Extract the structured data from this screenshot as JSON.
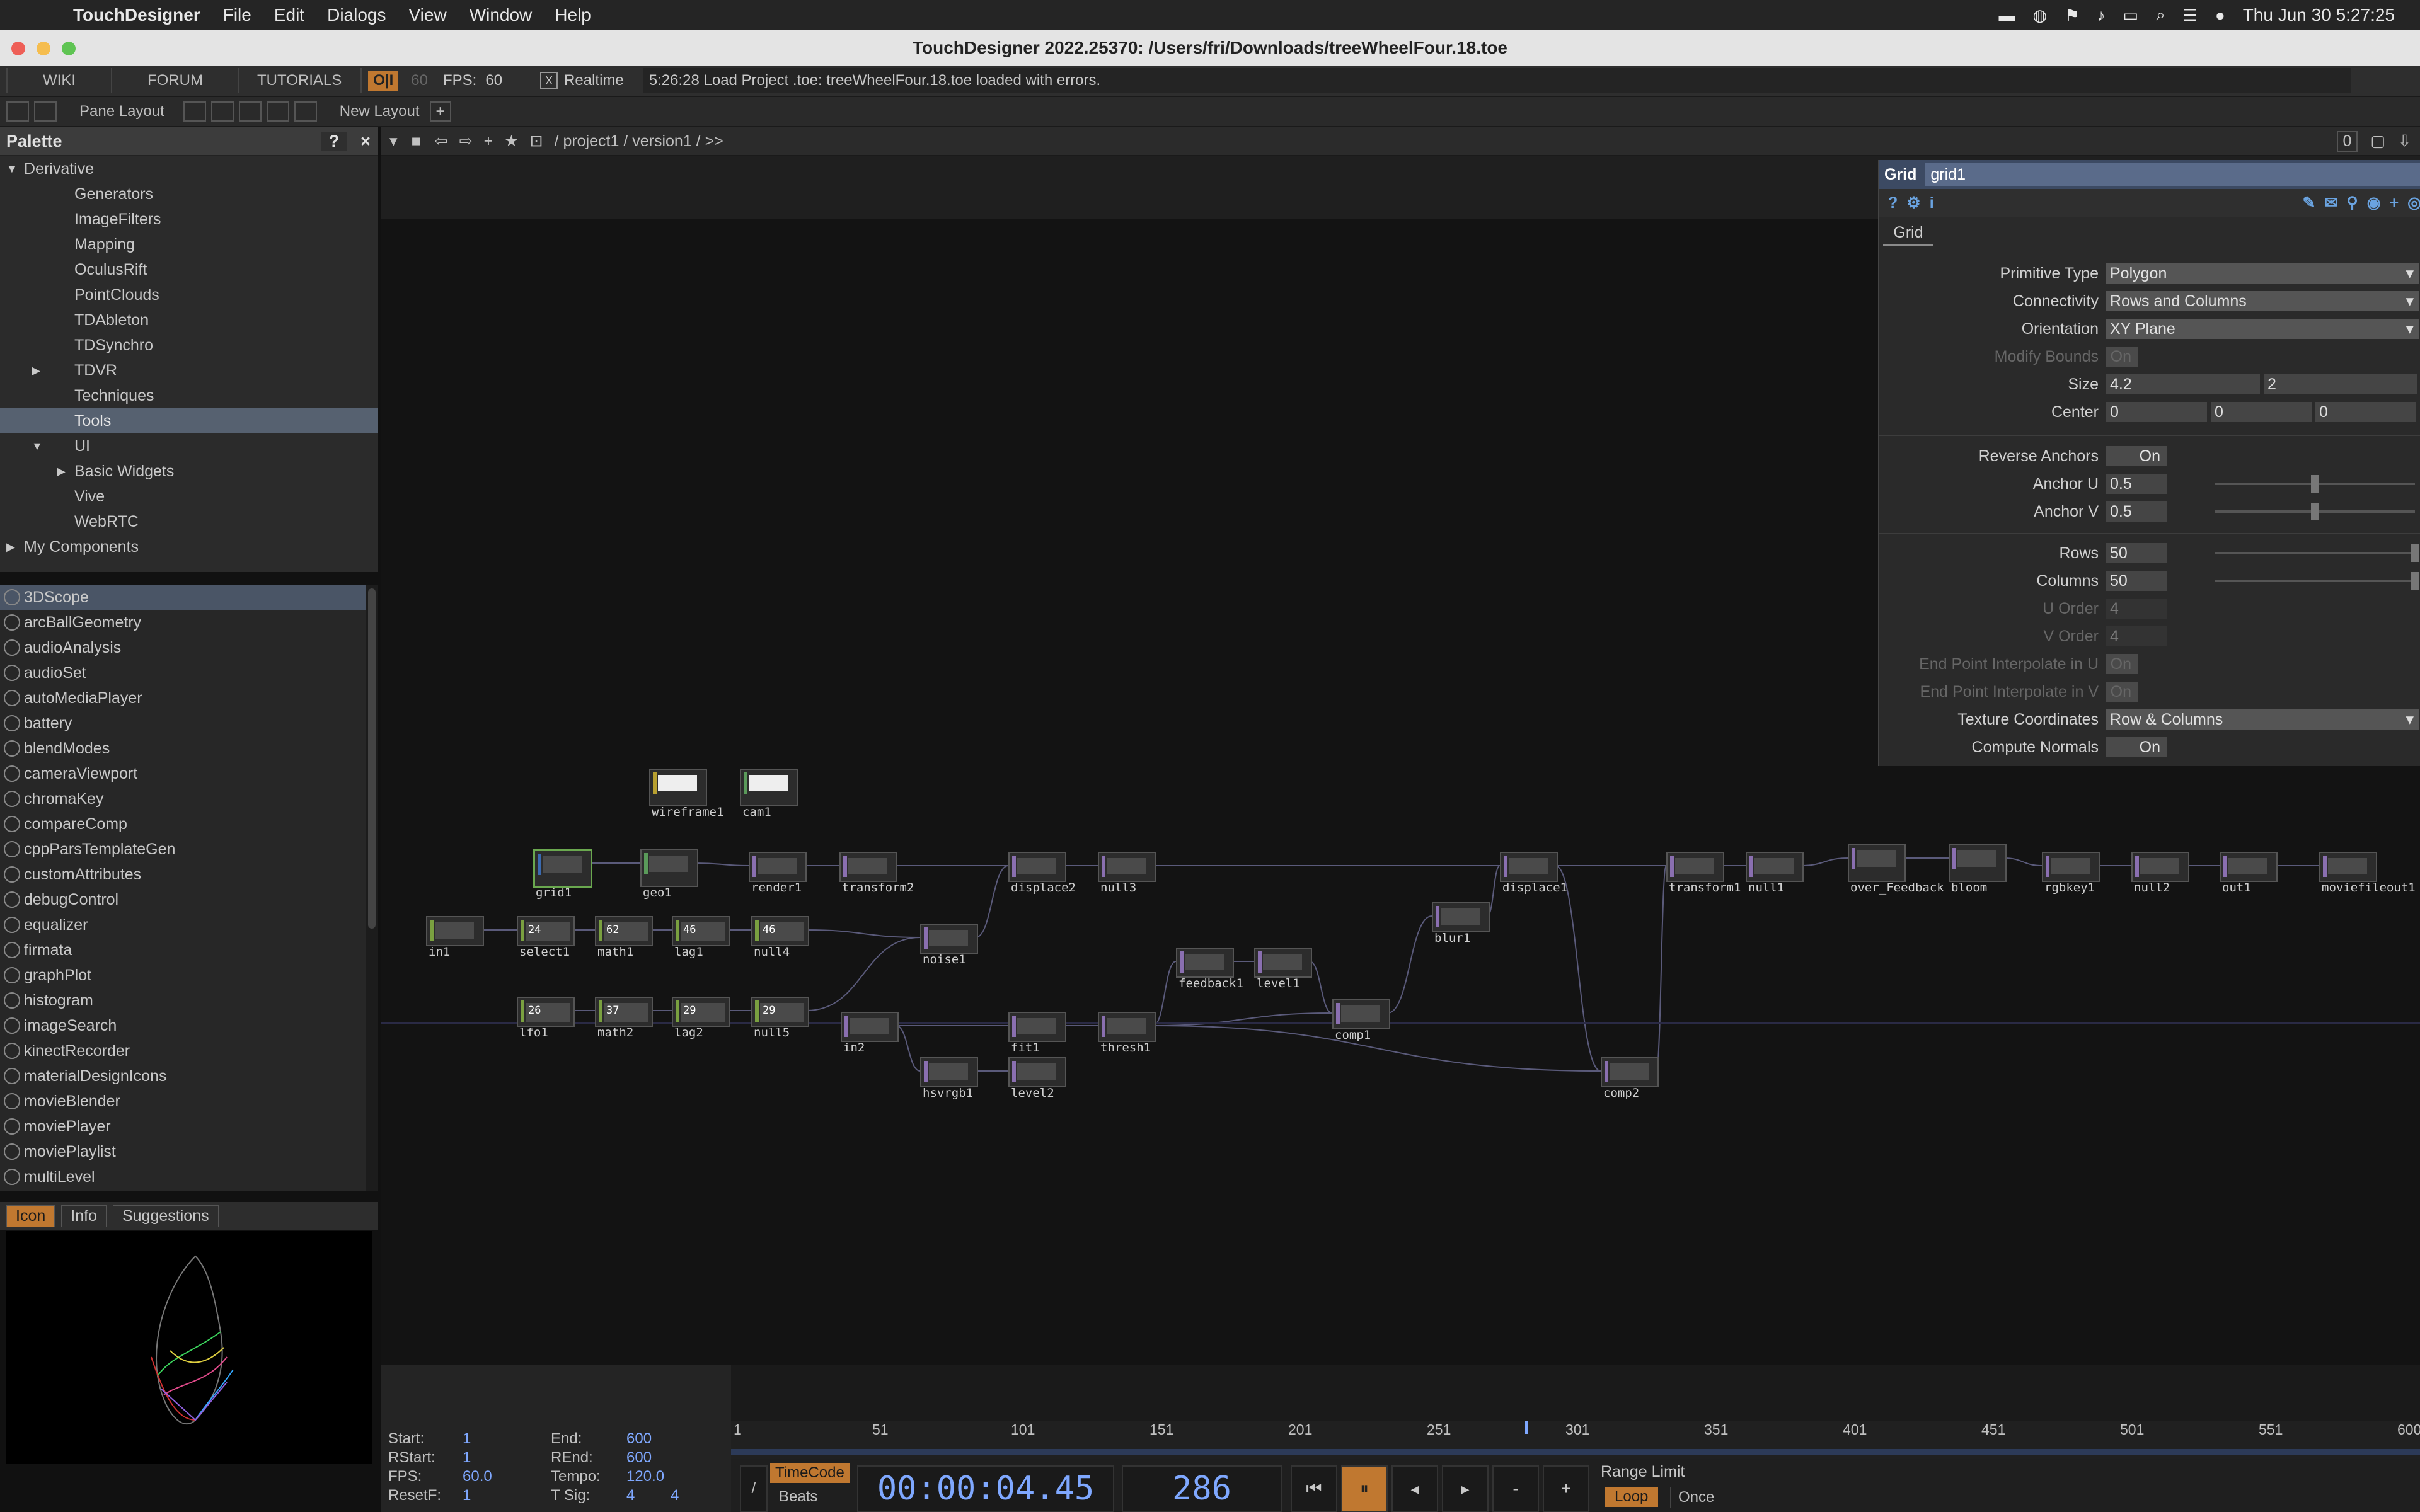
{
  "menubar": {
    "app": "TouchDesigner",
    "items": [
      "File",
      "Edit",
      "Dialogs",
      "View",
      "Window",
      "Help"
    ],
    "clock": "Thu Jun 30  5:27:25"
  },
  "window": {
    "title": "TouchDesigner 2022.25370: /Users/fri/Downloads/treeWheelFour.18.toe"
  },
  "toolbar": {
    "wiki": "WIKI",
    "forum": "FORUM",
    "tutorials": "TUTORIALS",
    "oi": "O|I",
    "fps_cap": "60",
    "fps_label": "FPS:",
    "fps_value": "60",
    "realtime_check": "X",
    "realtime": "Realtime",
    "status": "5:26:28 Load Project .toe: treeWheelFour.18.toe loaded with errors."
  },
  "layoutbar": {
    "pane_layout": "Pane Layout",
    "new_layout": "New Layout",
    "plus": "+"
  },
  "palette": {
    "title": "Palette",
    "help": "?",
    "close": "×",
    "tree": [
      {
        "label": "Derivative",
        "level": 0,
        "arrow": "down"
      },
      {
        "label": "Generators",
        "level": 1,
        "arrow": ""
      },
      {
        "label": "ImageFilters",
        "level": 1,
        "arrow": ""
      },
      {
        "label": "Mapping",
        "level": 1,
        "arrow": ""
      },
      {
        "label": "OculusRift",
        "level": 1,
        "arrow": ""
      },
      {
        "label": "PointClouds",
        "level": 1,
        "arrow": ""
      },
      {
        "label": "TDAbleton",
        "level": 1,
        "arrow": ""
      },
      {
        "label": "TDSynchro",
        "level": 1,
        "arrow": ""
      },
      {
        "label": "TDVR",
        "level": 1,
        "arrow": "right"
      },
      {
        "label": "Techniques",
        "level": 1,
        "arrow": ""
      },
      {
        "label": "Tools",
        "level": 1,
        "arrow": "",
        "selected": true
      },
      {
        "label": "UI",
        "level": 1,
        "arrow": "down"
      },
      {
        "label": "Basic Widgets",
        "level": 2,
        "arrow": "right"
      },
      {
        "label": "Vive",
        "level": 1,
        "arrow": ""
      },
      {
        "label": "WebRTC",
        "level": 1,
        "arrow": ""
      },
      {
        "label": "My Components",
        "level": 0,
        "arrow": "right"
      }
    ],
    "components": [
      "3DScope",
      "arcBallGeometry",
      "audioAnalysis",
      "audioSet",
      "autoMediaPlayer",
      "battery",
      "blendModes",
      "cameraViewport",
      "chromaKey",
      "compareComp",
      "cppParsTemplateGen",
      "customAttributes",
      "debugControl",
      "equalizer",
      "firmata",
      "graphPlot",
      "histogram",
      "imageSearch",
      "kinectRecorder",
      "materialDesignIcons",
      "movieBlender",
      "moviePlayer",
      "moviePlaylist",
      "multiLevel"
    ],
    "tabs": [
      "Icon",
      "Info",
      "Suggestions"
    ]
  },
  "network": {
    "path": "/ project1 / version1 / >>",
    "right_value": "0",
    "nodes": [
      {
        "name": "wireframe1"
      },
      {
        "name": "cam1"
      },
      {
        "name": "grid1"
      },
      {
        "name": "geo1"
      },
      {
        "name": "render1"
      },
      {
        "name": "transform2"
      },
      {
        "name": "displace2"
      },
      {
        "name": "null3"
      },
      {
        "name": "displace1"
      },
      {
        "name": "transform1"
      },
      {
        "name": "null1"
      },
      {
        "name": "over_Feedback"
      },
      {
        "name": "bloom"
      },
      {
        "name": "rgbkey1"
      },
      {
        "name": "null2"
      },
      {
        "name": "out1"
      },
      {
        "name": "moviefileout1"
      },
      {
        "name": "in1"
      },
      {
        "name": "select1",
        "val": "24"
      },
      {
        "name": "math1",
        "val": "62"
      },
      {
        "name": "lag1",
        "val": "46"
      },
      {
        "name": "null4",
        "val": "46"
      },
      {
        "name": "noise1"
      },
      {
        "name": "blur1"
      },
      {
        "name": "feedback1"
      },
      {
        "name": "level1"
      },
      {
        "name": "comp1"
      },
      {
        "name": "lfo1",
        "val": "26"
      },
      {
        "name": "math2",
        "val": "37"
      },
      {
        "name": "lag2",
        "val": "29"
      },
      {
        "name": "null5",
        "val": "29"
      },
      {
        "name": "in2"
      },
      {
        "name": "fit1"
      },
      {
        "name": "thresh1"
      },
      {
        "name": "hsvrgb1"
      },
      {
        "name": "level2"
      },
      {
        "name": "comp2"
      }
    ]
  },
  "params": {
    "op_type": "Grid",
    "op_name": "grid1",
    "page": "Grid",
    "primitive_type": {
      "label": "Primitive Type",
      "value": "Polygon"
    },
    "connectivity": {
      "label": "Connectivity",
      "value": "Rows and Columns"
    },
    "orientation": {
      "label": "Orientation",
      "value": "XY Plane"
    },
    "modify_bounds": {
      "label": "Modify Bounds",
      "value": "On"
    },
    "size": {
      "label": "Size",
      "x": "4.2",
      "y": "2"
    },
    "center": {
      "label": "Center",
      "x": "0",
      "y": "0",
      "z": "0"
    },
    "reverse_anchors": {
      "label": "Reverse Anchors",
      "value": "On"
    },
    "anchor_u": {
      "label": "Anchor U",
      "value": "0.5",
      "fraction": 0.5
    },
    "anchor_v": {
      "label": "Anchor V",
      "value": "0.5",
      "fraction": 0.5
    },
    "rows": {
      "label": "Rows",
      "value": "50",
      "fraction": 1.0
    },
    "columns": {
      "label": "Columns",
      "value": "50",
      "fraction": 1.0
    },
    "u_order": {
      "label": "U Order",
      "value": "4"
    },
    "v_order": {
      "label": "V Order",
      "value": "4"
    },
    "epi_u": {
      "label": "End Point Interpolate in U",
      "value": "On"
    },
    "epi_v": {
      "label": "End Point Interpolate in V",
      "value": "On"
    },
    "texture_coords": {
      "label": "Texture Coordinates",
      "value": "Row & Columns"
    },
    "compute_normals": {
      "label": "Compute Normals",
      "value": "On"
    }
  },
  "timeline": {
    "start_label": "Start:",
    "start": "1",
    "end_label": "End:",
    "end": "600",
    "rstart_label": "RStart:",
    "rstart": "1",
    "rend_label": "REnd:",
    "rend": "600",
    "fps_label": "FPS:",
    "fps": "60.0",
    "tempo_label": "Tempo:",
    "tempo": "120.0",
    "resetf_label": "ResetF:",
    "resetf": "1",
    "tsig_label": "T Sig:",
    "tsig_a": "4",
    "tsig_b": "4",
    "ticks": [
      "1",
      "51",
      "101",
      "151",
      "201",
      "251",
      "301",
      "351",
      "401",
      "451",
      "501",
      "551",
      "600"
    ],
    "timecode_btn": "TimeCode",
    "beats_btn": "Beats",
    "timecode": "00:00:04.45",
    "frame": "286",
    "range_limit": "Range Limit",
    "loop": "Loop",
    "once": "Once",
    "minus": "-",
    "plus": "+"
  }
}
